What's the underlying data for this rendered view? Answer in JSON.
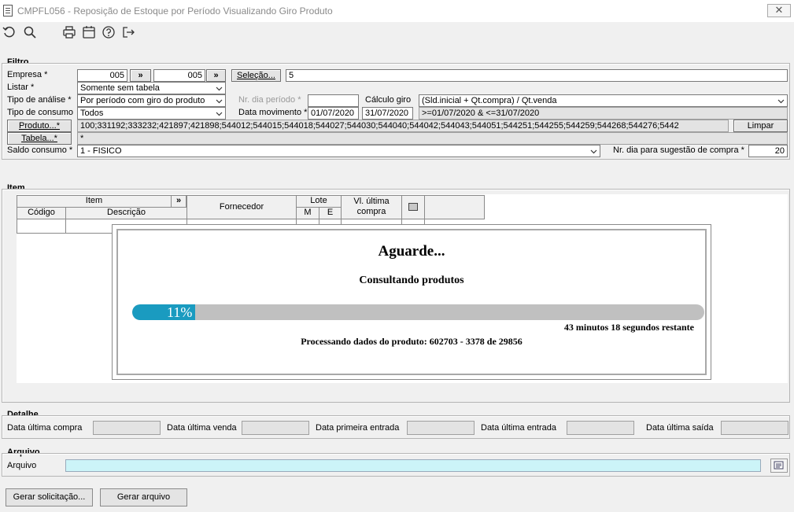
{
  "window": {
    "title": "CMPFL056 - Reposição de Estoque por Período Visualizando Giro Produto",
    "close_label": "✕"
  },
  "toolbar": {
    "icons": [
      "undo-icon",
      "search-icon",
      "print-icon",
      "calendar-icon",
      "help-icon",
      "exit-icon"
    ]
  },
  "filtro": {
    "group_label": "Filtro",
    "empresa_label": "Empresa *",
    "empresa_from": "005",
    "empresa_to": "005",
    "range_btn": "»",
    "selecao_btn": "Seleção...",
    "selecao_value": "5",
    "listar_label": "Listar *",
    "listar_value": "Somente sem tabela",
    "tipo_analise_label": "Tipo de análise *",
    "tipo_analise_value": "Por período com giro do produto",
    "nr_dia_periodo_label": "Nr. dia período *",
    "calculo_giro_label": "Cálculo giro",
    "calculo_giro_value": "(Sld.inicial + Qt.compra) / Qt.venda",
    "tipo_consumo_label": "Tipo de consumo",
    "tipo_consumo_value": "Todos",
    "data_movimento_label": "Data movimento *",
    "data_movimento_from": "01/07/2020",
    "data_movimento_to": "31/07/2020",
    "data_movimento_expr": ">=01/07/2020 & <=31/07/2020",
    "produto_btn": "Produto...*",
    "produto_value": "100;331192;333232;421897;421898;544012;544015;544018;544027;544030;544040;544042;544043;544051;544251;544255;544259;544268;544276;5442",
    "limpar_btn": "Limpar",
    "tabela_btn": "Tabela...*",
    "tabela_value": "*",
    "saldo_consumo_label": "Saldo consumo *",
    "saldo_consumo_value": "1 - FISICO",
    "nr_dia_sugestao_label": "Nr. dia para sugestão de compra *",
    "nr_dia_sugestao_value": "20"
  },
  "item": {
    "group_label": "Item",
    "headers": {
      "item": "Item",
      "expand": "»",
      "codigo": "Código",
      "descricao": "Descrição",
      "fornecedor": "Fornecedor",
      "lote": "Lote",
      "lote_m": "M",
      "lote_e": "E",
      "vl_ultima_compra": "Vl. última compra"
    }
  },
  "dialog": {
    "title": "Aguarde...",
    "subtitle": "Consultando produtos",
    "progress_percent": 11,
    "progress_label": "11%",
    "remaining": "43 minutos 18 segundos restante",
    "status": "Processando dados do produto: 602703 - 3378 de 29856"
  },
  "detalhe": {
    "group_label": "Detalhe",
    "data_ultima_compra": "Data última compra",
    "data_ultima_venda": "Data última venda",
    "data_primeira_entrada": "Data primeira entrada",
    "data_ultima_entrada": "Data última entrada",
    "data_ultima_saida": "Data última saída"
  },
  "arquivo": {
    "group_label": "Arquivo",
    "arquivo_label": "Arquivo",
    "arquivo_value": ""
  },
  "footer": {
    "gerar_solicitacao_btn": "Gerar solicitação...",
    "gerar_arquivo_btn": "Gerar arquivo"
  }
}
